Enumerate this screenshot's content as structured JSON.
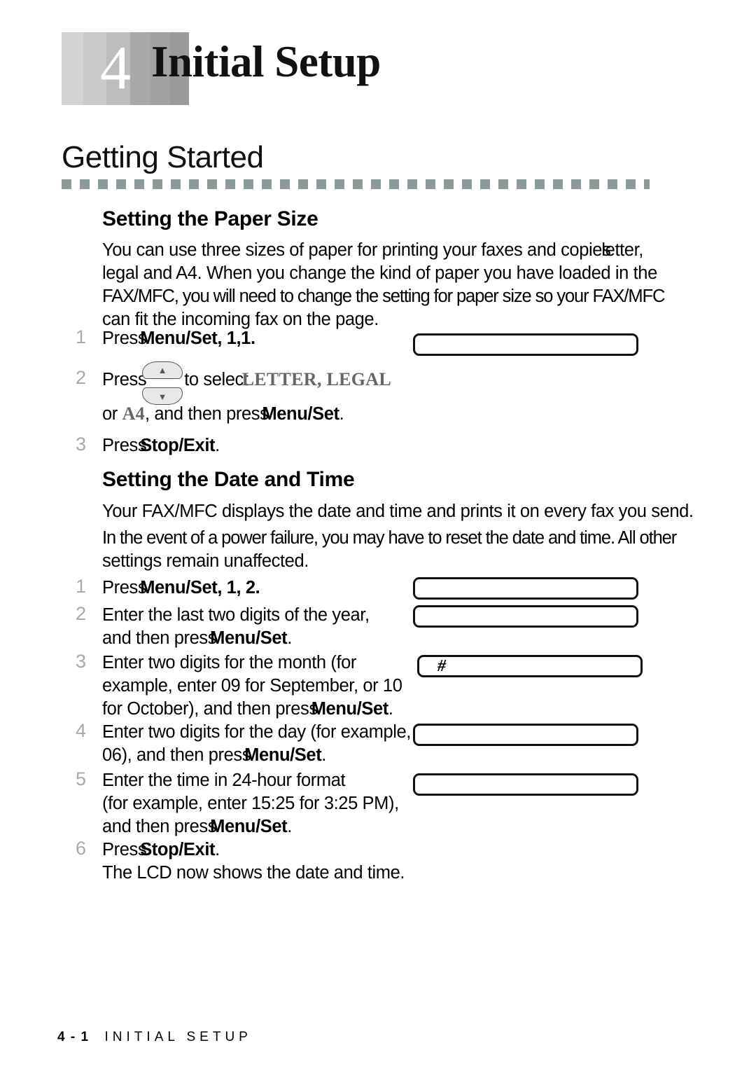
{
  "chapter": {
    "number": "4",
    "title": "Initial Setup"
  },
  "section": {
    "heading": "Getting Started"
  },
  "paper_size": {
    "heading": "Setting the Paper Size",
    "intro_line1a": "You can use three sizes of paper for printing your faxes and copies",
    "intro_line1b": "letter,",
    "intro_line2": "legal and A4.   When you change the kind of paper you have loaded in the",
    "intro_line3": "FAX/MFC, you will need to change the setting for paper size so your FAX/MFC",
    "intro_line4": "can fit the incoming fax on the page.",
    "steps": [
      {
        "num": "1",
        "press": "Press",
        "key": "Menu/Set",
        "suffix": ", 1,1."
      },
      {
        "num": "2",
        "press": "Press",
        "mid": "to select",
        "options1": "LETTER, LEGAL",
        "line2_a": "or ",
        "options2": "A4",
        "line2_b": ", and then press",
        "key": "Menu/Set",
        "suffix": "."
      },
      {
        "num": "3",
        "press": "Press",
        "key": "Stop/Exit",
        "suffix": "."
      }
    ],
    "lcd": [
      {
        "text": ""
      }
    ]
  },
  "date_time": {
    "heading": "Setting the Date and Time",
    "intro_line1": "Your FAX/MFC displays the date and time and prints it on every fax you send.",
    "intro_line2": "In the event of a power failure, you may have to reset the date and time. All other",
    "intro_line3": "settings remain unaffected.",
    "steps": [
      {
        "num": "1",
        "press": "Press",
        "key": "Menu/Set",
        "suffix": ", 1, 2."
      },
      {
        "num": "2",
        "line1": "Enter the last two digits of the year,",
        "line2_a": "and then press",
        "key": "Menu/Set",
        "suffix": "."
      },
      {
        "num": "3",
        "line1": "Enter two digits for the month (for",
        "line2": "example, enter 09 for September, or 10",
        "line3_a": "for October), and then press",
        "key": "Menu/Set",
        "suffix": "."
      },
      {
        "num": "4",
        "line1": "Enter two digits for the day (for example,",
        "line2_a": "06), and then press",
        "key": "Menu/Set",
        "suffix": "."
      },
      {
        "num": "5",
        "line1": "Enter the time in 24-hour format",
        "line2": "(for example, enter 15:25 for 3:25 PM),",
        "line3_a": "and then press",
        "key": "Menu/Set",
        "suffix": "."
      },
      {
        "num": "6",
        "press": "Press",
        "key": "Stop/Exit",
        "suffix": ".",
        "line2": "The LCD now shows the date and time."
      }
    ],
    "lcd": [
      {
        "text": ""
      },
      {
        "text": ""
      },
      {
        "text": "#"
      },
      {
        "text": ""
      },
      {
        "text": ""
      }
    ]
  },
  "footer": {
    "page_number": "4 - 1",
    "crumb": "INITIAL SETUP"
  },
  "icons": {
    "arrow_up": "▲",
    "arrow_down": "▼"
  },
  "colors": {
    "rule": "#8b9b9b",
    "step_number": "#a9a9a9",
    "option_text": "#666666",
    "banner_light": "#d3d3d3",
    "banner_dark": "#9a9a9a"
  }
}
